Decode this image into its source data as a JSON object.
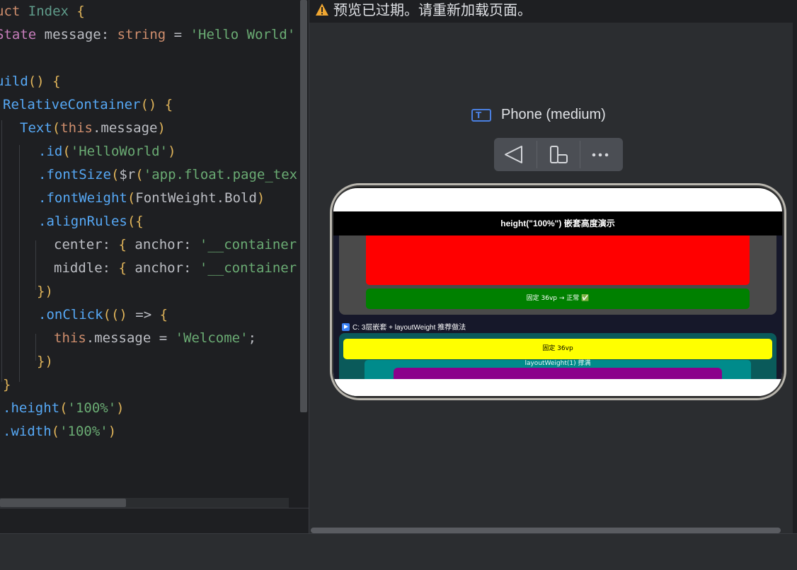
{
  "editor": {
    "lines": [
      {
        "parts": [
          [
            "kw",
            "uct "
          ],
          [
            "cls",
            "Index "
          ],
          [
            "br",
            "{"
          ]
        ]
      },
      {
        "parts": [
          [
            "sv",
            "State "
          ],
          [
            "pl",
            "message: "
          ],
          [
            "type",
            "string "
          ],
          [
            "pl",
            "= "
          ],
          [
            "str",
            "'Hello World'"
          ]
        ]
      },
      {
        "parts": []
      },
      {
        "parts": [
          [
            "fn",
            "uild"
          ],
          [
            "br",
            "() {"
          ]
        ]
      },
      {
        "parts": [
          [
            "fn",
            "RelativeContainer"
          ],
          [
            "br",
            "() {"
          ]
        ]
      },
      {
        "parts": [
          [
            "fn",
            "Text"
          ],
          [
            "br",
            "("
          ],
          [
            "kw",
            "this"
          ],
          [
            "pl",
            ".message"
          ],
          [
            "br",
            ")"
          ]
        ]
      },
      {
        "parts": [
          [
            "fn",
            ".id"
          ],
          [
            "br",
            "("
          ],
          [
            "str",
            "'HelloWorld'"
          ],
          [
            "br",
            ")"
          ]
        ]
      },
      {
        "parts": [
          [
            "fn",
            ".fontSize"
          ],
          [
            "br",
            "("
          ],
          [
            "pl",
            "$r"
          ],
          [
            "br",
            "("
          ],
          [
            "str",
            "'app.float.page_tex"
          ]
        ]
      },
      {
        "parts": [
          [
            "fn",
            ".fontWeight"
          ],
          [
            "br",
            "("
          ],
          [
            "pl",
            "FontWeight.Bold"
          ],
          [
            "br",
            ")"
          ]
        ]
      },
      {
        "parts": [
          [
            "fn",
            ".alignRules"
          ],
          [
            "br",
            "({"
          ]
        ]
      },
      {
        "parts": [
          [
            "pl",
            "center: "
          ],
          [
            "br",
            "{ "
          ],
          [
            "pl",
            "anchor: "
          ],
          [
            "str",
            "'__container"
          ]
        ]
      },
      {
        "parts": [
          [
            "pl",
            "middle: "
          ],
          [
            "br",
            "{ "
          ],
          [
            "pl",
            "anchor: "
          ],
          [
            "str",
            "'__container"
          ]
        ]
      },
      {
        "parts": [
          [
            "br",
            "})"
          ]
        ]
      },
      {
        "parts": [
          [
            "fn",
            ".onClick"
          ],
          [
            "br",
            "(() "
          ],
          [
            "pl",
            "=> "
          ],
          [
            "br",
            "{"
          ]
        ]
      },
      {
        "parts": [
          [
            "kw",
            "this"
          ],
          [
            "pl",
            ".message = "
          ],
          [
            "str",
            "'Welcome'"
          ],
          [
            "pl",
            ";"
          ]
        ]
      },
      {
        "parts": [
          [
            "br",
            "})"
          ]
        ]
      },
      {
        "parts": [
          [
            "br",
            "}"
          ]
        ]
      },
      {
        "parts": [
          [
            "fn",
            ".height"
          ],
          [
            "br",
            "("
          ],
          [
            "str",
            "'100%'"
          ],
          [
            "br",
            ")"
          ]
        ]
      },
      {
        "parts": [
          [
            "fn",
            ".width"
          ],
          [
            "br",
            "("
          ],
          [
            "str",
            "'100%'"
          ],
          [
            "br",
            ")"
          ]
        ]
      }
    ]
  },
  "preview": {
    "banner_text": "预览已过期。请重新加载页面。",
    "device_icon_letter": "T",
    "device_name": "Phone (medium)",
    "toolbar": {
      "back_icon": "back-triangle-icon",
      "rotate_icon": "rotate-device-icon",
      "more_icon": "more-icon"
    }
  },
  "app": {
    "title": "height(\"100%\") 嵌套高度演示",
    "fixed_green_label": "固定 36vp → 正常 ✅",
    "section_c_title": "C:  3层嵌套 + layoutWeight 推荐做法",
    "fixed_yellow_label": "固定 36vp",
    "layout_weight_label": "layoutWeight(1) 撑满"
  },
  "colors": {
    "accent": "#4a7fe0",
    "warning": "#f0a732",
    "red": "#ff0000",
    "green": "#008000",
    "yellow": "#ffff00",
    "teal": "#008b8b",
    "purple": "#8b008b"
  }
}
